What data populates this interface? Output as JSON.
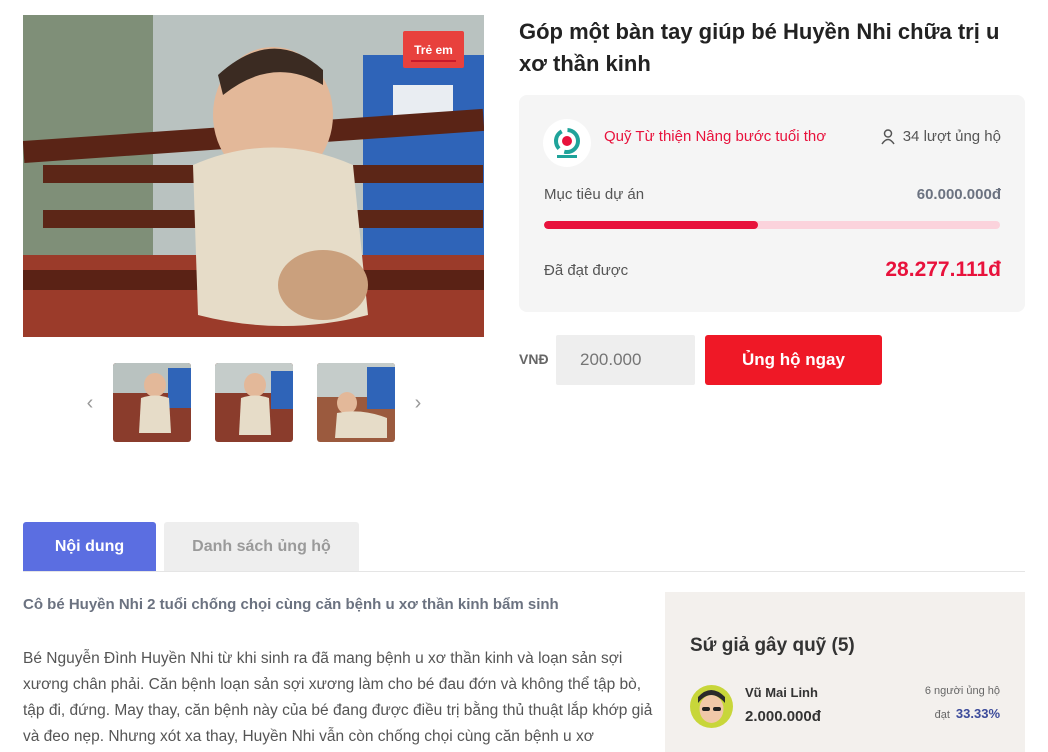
{
  "campaign": {
    "category_badge": "Trẻ em",
    "title": "Góp một bàn tay giúp bé Huyền Nhi chữa trị u xơ thần kinh",
    "organization": "Quỹ Từ thiện Nâng bước tuổi thơ",
    "supporters": "34 lượt ủng hộ",
    "goal_label": "Mục tiêu dự án",
    "goal_value": "60.000.000đ",
    "raised_label": "Đã đạt được",
    "raised_value": "28.277.111đ",
    "progress_fraction": 0.47
  },
  "donate": {
    "currency": "VNĐ",
    "amount_placeholder": "200.000",
    "button_label": "Ủng hộ ngay"
  },
  "tabs": [
    {
      "label": "Nội dung"
    },
    {
      "label": "Danh sách ủng hộ"
    }
  ],
  "article": {
    "lead": "Cô bé Huyền Nhi 2 tuổi chống chọi cùng căn bệnh u xơ thần kinh bẩm sinh",
    "body": "Bé Nguyễn Đình Huyền Nhi từ khi sinh ra đã mang bệnh u xơ thần kinh và loạn sản sợi xương chân phải. Căn bệnh loạn sản sợi xương làm cho bé đau đớn và không thể tập bò, tập đi, đứng. May thay, căn bệnh này của bé đang được điều trị bằng thủ thuật lắp khớp giả và đeo nẹp. Nhưng xót xa thay, Huyền Nhi vẫn còn chống chọi cùng căn bệnh u xơ"
  },
  "ambassadors": {
    "title": "Sứ giả gây quỹ (5)",
    "items": [
      {
        "name": "Vũ Mai Linh",
        "amount": "2.000.000đ",
        "count": "6 người ủng hộ",
        "reach_label": "đạt",
        "reach_pct": "33.33%"
      }
    ]
  },
  "icons": {
    "prev": "chevron-left-icon",
    "next": "chevron-right-icon",
    "supporters": "person-icon"
  },
  "colors": {
    "accent_red": "#e8123c",
    "button_red": "#ef1826",
    "tab_active": "#5b6ee1",
    "progress_track": "#fbd3dc"
  }
}
